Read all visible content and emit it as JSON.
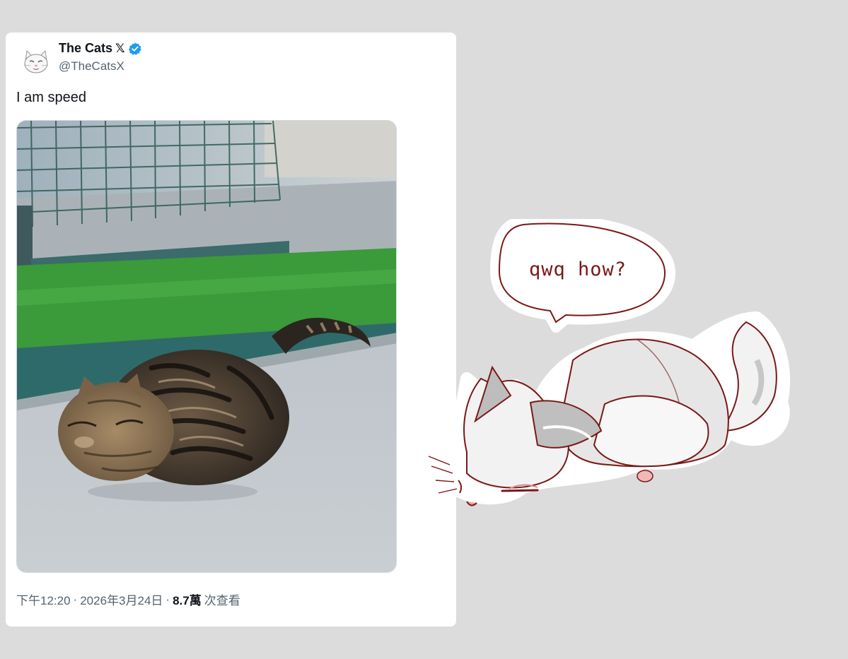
{
  "tweet": {
    "author": {
      "display_name": "The Cats",
      "x_mark": "𝕏",
      "handle": "@TheCatsX",
      "avatar_icon": "cat-avatar-icon",
      "verified_icon": "verified-badge-icon",
      "verified_color": "#1d9bf0"
    },
    "text": "I am speed",
    "media": {
      "icon": "running-tabby-cat-photo"
    },
    "meta": {
      "time": "下午12:20",
      "separator1": "·",
      "date": "2026年3月24日",
      "separator2": "·",
      "views_count": "8.7萬",
      "views_label": "次查看"
    }
  },
  "sticker": {
    "speech_bubble_text": "qwq how?",
    "icon": "sleeping-fox-cat-sticker",
    "ink_color": "#7a1818"
  },
  "colors": {
    "background": "#dcdcdc",
    "card": "#ffffff",
    "text_primary": "#0f1419",
    "text_secondary": "#536471"
  }
}
